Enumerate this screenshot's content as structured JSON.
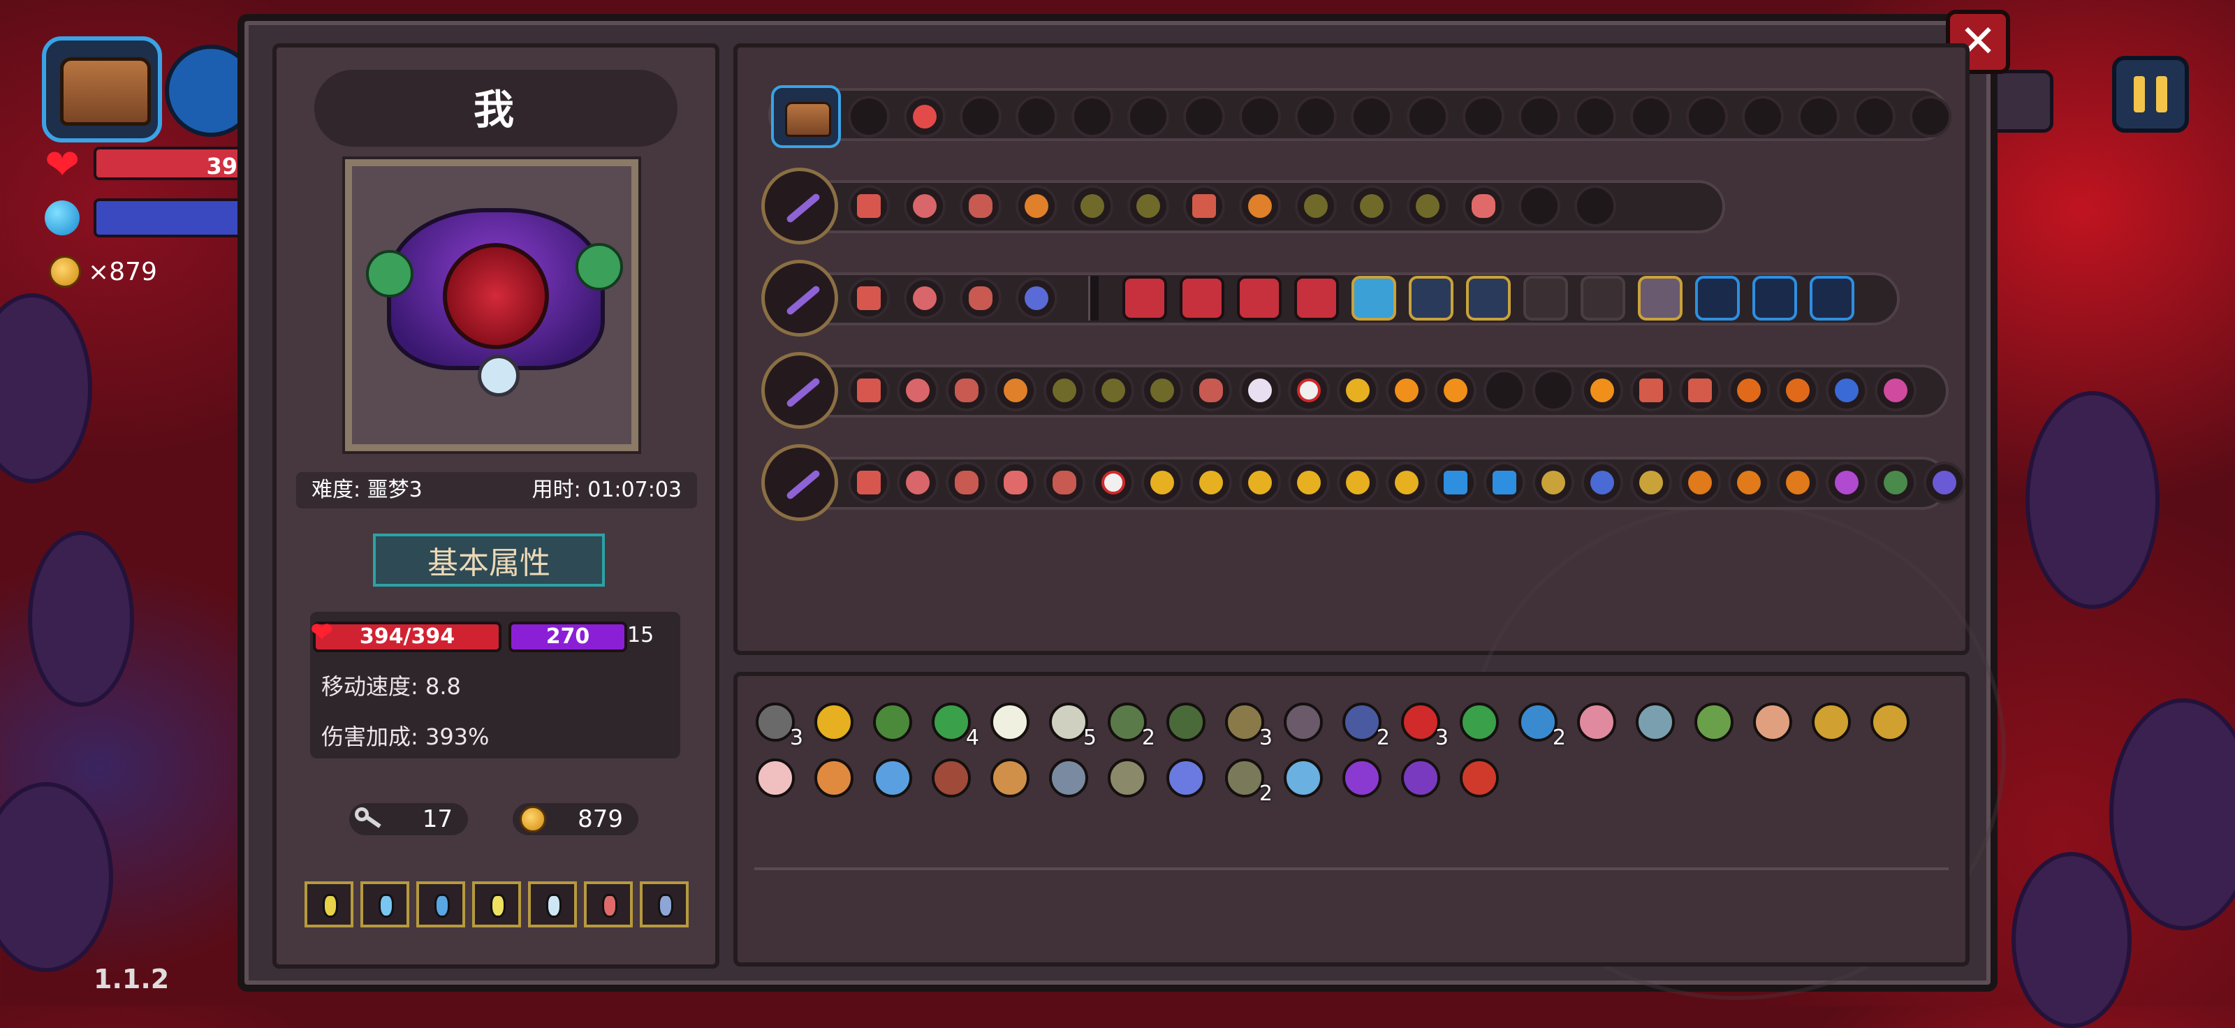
{
  "hud": {
    "hp_value": "39",
    "coins": "×879",
    "version": "1.1.2"
  },
  "profile": {
    "name": "我",
    "difficulty": "难度: 噩梦3",
    "time": "用时: 01:07:03",
    "tab_label": "基本属性",
    "hp": "394/394",
    "mp": "270",
    "mp_extra": "15",
    "move_speed": "移动速度: 8.8",
    "damage_bonus": "伤害加成: 393%",
    "keys": "17",
    "gold": "879"
  },
  "colors": {
    "panel": "#3b3038",
    "hp": "#d12232",
    "mp": "#8b1fd6",
    "accent_teal": "#2ba3a6",
    "gold_border": "#b69a3e"
  },
  "item_counts_row1": [
    "3",
    "",
    "",
    "4",
    "",
    "5",
    "2",
    "",
    "3",
    "",
    "2",
    "3",
    "",
    "2",
    "",
    "",
    "",
    "",
    "",
    "",
    ""
  ],
  "item_counts_row2": [
    "",
    "",
    "",
    "",
    "",
    "",
    "",
    "",
    "2",
    "",
    "",
    "",
    ""
  ]
}
